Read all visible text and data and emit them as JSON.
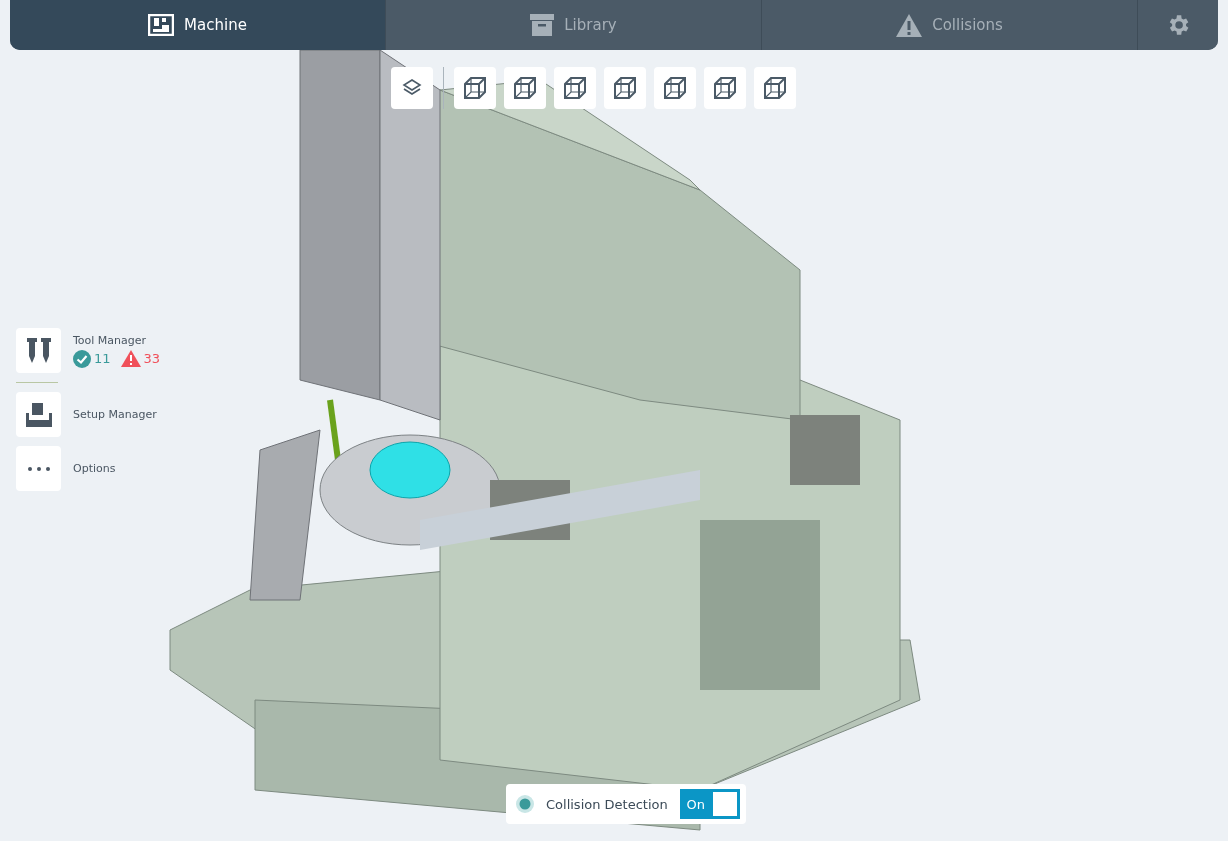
{
  "tabs": [
    {
      "kind": "machine",
      "label": "Machine",
      "selected": true
    },
    {
      "kind": "library",
      "label": "Library",
      "selected": false
    },
    {
      "kind": "collisions",
      "label": "Collisions",
      "selected": false
    }
  ],
  "side_panel": {
    "items": [
      {
        "kind": "tools",
        "label": "Tool Manager",
        "ok_count": "11",
        "warning_count": "33"
      },
      {
        "kind": "setup",
        "label": "Setup Manager"
      },
      {
        "kind": "options",
        "label": "Options"
      }
    ]
  },
  "collision_detection": {
    "label": "Collision Detection",
    "on": true,
    "toggle_label": "On"
  }
}
